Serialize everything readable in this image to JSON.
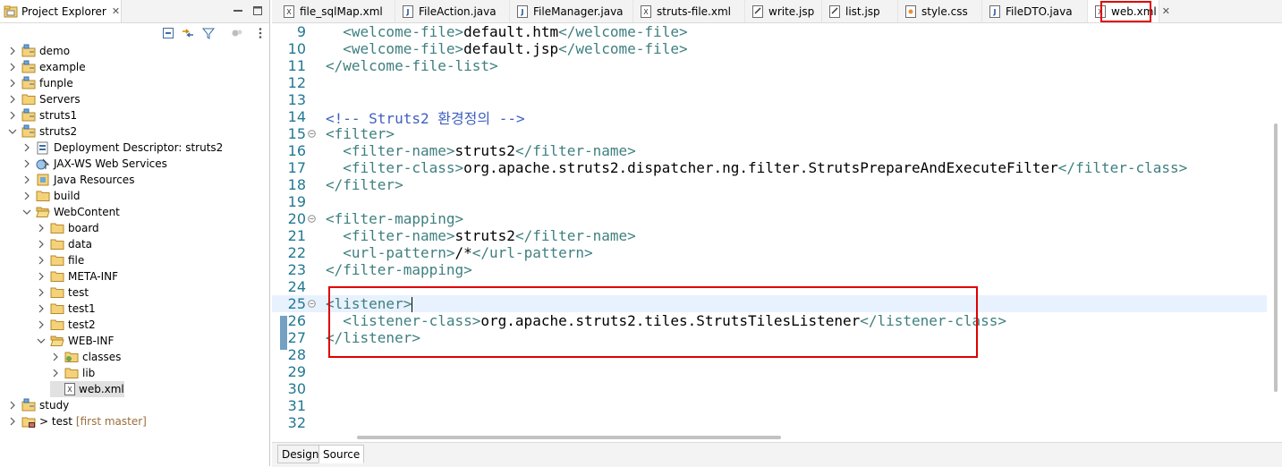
{
  "explorer": {
    "title": "Project Explorer",
    "close_glyph": "✕",
    "tree": [
      {
        "label": "demo",
        "depth": 0,
        "arrow": "collapsed",
        "icon": "project-icon"
      },
      {
        "label": "example",
        "depth": 0,
        "arrow": "collapsed",
        "icon": "project-icon"
      },
      {
        "label": "funple",
        "depth": 0,
        "arrow": "collapsed",
        "icon": "project-icon"
      },
      {
        "label": "Servers",
        "depth": 0,
        "arrow": "collapsed",
        "icon": "folder-icon"
      },
      {
        "label": "struts1",
        "depth": 0,
        "arrow": "collapsed",
        "icon": "project-icon"
      },
      {
        "label": "struts2",
        "depth": 0,
        "arrow": "expanded",
        "icon": "project-icon"
      },
      {
        "label": "Deployment Descriptor: struts2",
        "depth": 1,
        "arrow": "collapsed",
        "icon": "deployment-descriptor-icon"
      },
      {
        "label": "JAX-WS Web Services",
        "depth": 1,
        "arrow": "collapsed",
        "icon": "web-services-icon"
      },
      {
        "label": "Java Resources",
        "depth": 1,
        "arrow": "collapsed",
        "icon": "java-resources-icon"
      },
      {
        "label": "build",
        "depth": 1,
        "arrow": "collapsed",
        "icon": "folder-icon"
      },
      {
        "label": "WebContent",
        "depth": 1,
        "arrow": "expanded",
        "icon": "folder-open-icon"
      },
      {
        "label": "board",
        "depth": 2,
        "arrow": "collapsed",
        "icon": "folder-icon"
      },
      {
        "label": "data",
        "depth": 2,
        "arrow": "collapsed",
        "icon": "folder-icon"
      },
      {
        "label": "file",
        "depth": 2,
        "arrow": "collapsed",
        "icon": "folder-icon"
      },
      {
        "label": "META-INF",
        "depth": 2,
        "arrow": "collapsed",
        "icon": "folder-icon"
      },
      {
        "label": "test",
        "depth": 2,
        "arrow": "collapsed",
        "icon": "folder-icon"
      },
      {
        "label": "test1",
        "depth": 2,
        "arrow": "collapsed",
        "icon": "folder-icon"
      },
      {
        "label": "test2",
        "depth": 2,
        "arrow": "collapsed",
        "icon": "folder-icon"
      },
      {
        "label": "WEB-INF",
        "depth": 2,
        "arrow": "expanded",
        "icon": "folder-open-icon"
      },
      {
        "label": "classes",
        "depth": 3,
        "arrow": "collapsed",
        "icon": "classes-folder-icon"
      },
      {
        "label": "lib",
        "depth": 3,
        "arrow": "collapsed",
        "icon": "folder-icon"
      },
      {
        "label": "web.xml",
        "depth": 3,
        "arrow": "none",
        "icon": "xml-file-icon",
        "selected": true
      },
      {
        "label": "study",
        "depth": 0,
        "arrow": "collapsed",
        "icon": "project-icon"
      },
      {
        "label": "> test",
        "depth": 0,
        "arrow": "collapsed",
        "icon": "git-project-icon",
        "decoration": "[first master]"
      }
    ]
  },
  "editor": {
    "tabs": [
      {
        "label": "file_sqlMap.xml",
        "icon": "xml-file-icon"
      },
      {
        "label": "FileAction.java",
        "icon": "java-file-icon"
      },
      {
        "label": "FileManager.java",
        "icon": "java-file-icon"
      },
      {
        "label": "struts-file.xml",
        "icon": "xml-file-icon"
      },
      {
        "label": "write.jsp",
        "icon": "jsp-file-icon"
      },
      {
        "label": "list.jsp",
        "icon": "jsp-file-icon"
      },
      {
        "label": "style.css",
        "icon": "css-file-icon"
      },
      {
        "label": "FileDTO.java",
        "icon": "java-file-icon"
      },
      {
        "label": "web.xml",
        "icon": "xml-file-icon",
        "active": true
      }
    ],
    "close_glyph": "✕",
    "lines": [
      {
        "n": "9",
        "fold": false,
        "segments": [
          [
            "",
            "  "
          ],
          [
            "tag",
            "<welcome-file>"
          ],
          [
            "",
            "default.htm"
          ],
          [
            "tag",
            "</welcome-file>"
          ]
        ]
      },
      {
        "n": "10",
        "fold": false,
        "segments": [
          [
            "",
            "  "
          ],
          [
            "tag",
            "<welcome-file>"
          ],
          [
            "",
            "default.jsp"
          ],
          [
            "tag",
            "</welcome-file>"
          ]
        ]
      },
      {
        "n": "11",
        "fold": false,
        "segments": [
          [
            "tag",
            "</welcome-file-list>"
          ]
        ]
      },
      {
        "n": "12",
        "fold": false,
        "segments": []
      },
      {
        "n": "13",
        "fold": false,
        "segments": []
      },
      {
        "n": "14",
        "fold": false,
        "segments": [
          [
            "cmt",
            "<!-- Struts2 환경정의 -->"
          ]
        ]
      },
      {
        "n": "15",
        "fold": true,
        "segments": [
          [
            "tag",
            "<filter>"
          ]
        ]
      },
      {
        "n": "16",
        "fold": false,
        "segments": [
          [
            "",
            "  "
          ],
          [
            "tag",
            "<filter-name>"
          ],
          [
            "",
            "struts2"
          ],
          [
            "tag",
            "</filter-name>"
          ]
        ]
      },
      {
        "n": "17",
        "fold": false,
        "segments": [
          [
            "",
            "  "
          ],
          [
            "tag",
            "<filter-class>"
          ],
          [
            "",
            "org.apache.struts2.dispatcher.ng.filter.StrutsPrepareAndExecuteFilter"
          ],
          [
            "tag",
            "</filter-class>"
          ]
        ]
      },
      {
        "n": "18",
        "fold": false,
        "segments": [
          [
            "tag",
            "</filter>"
          ]
        ]
      },
      {
        "n": "19",
        "fold": false,
        "segments": []
      },
      {
        "n": "20",
        "fold": true,
        "segments": [
          [
            "tag",
            "<filter-mapping>"
          ]
        ]
      },
      {
        "n": "21",
        "fold": false,
        "segments": [
          [
            "",
            "  "
          ],
          [
            "tag",
            "<filter-name>"
          ],
          [
            "",
            "struts2"
          ],
          [
            "tag",
            "</filter-name>"
          ]
        ]
      },
      {
        "n": "22",
        "fold": false,
        "segments": [
          [
            "",
            "  "
          ],
          [
            "tag",
            "<url-pattern>"
          ],
          [
            "",
            "/*"
          ],
          [
            "tag",
            "</url-pattern>"
          ]
        ]
      },
      {
        "n": "23",
        "fold": false,
        "segments": [
          [
            "tag",
            "</filter-mapping>"
          ]
        ]
      },
      {
        "n": "24",
        "fold": false,
        "segments": []
      },
      {
        "n": "25",
        "fold": true,
        "current": true,
        "segments": [
          [
            "tag",
            "<listener>"
          ]
        ]
      },
      {
        "n": "26",
        "fold": false,
        "segments": [
          [
            "",
            "  "
          ],
          [
            "tag",
            "<listener-class>"
          ],
          [
            "",
            "org.apache.struts2.tiles.StrutsTilesListener"
          ],
          [
            "tag",
            "</listener-class>"
          ]
        ]
      },
      {
        "n": "27",
        "fold": false,
        "segments": [
          [
            "tag",
            "</listener>"
          ]
        ]
      },
      {
        "n": "28",
        "fold": false,
        "segments": []
      },
      {
        "n": "29",
        "fold": false,
        "segments": []
      },
      {
        "n": "30",
        "fold": false,
        "segments": []
      },
      {
        "n": "31",
        "fold": false,
        "segments": []
      },
      {
        "n": "32",
        "fold": false,
        "segments": []
      }
    ],
    "bottom_tabs": [
      {
        "label": "Design",
        "active": false
      },
      {
        "label": "Source",
        "active": true
      }
    ]
  },
  "colors": {
    "tag": "#3f7f7f",
    "comment": "#3f5fbf",
    "line_number": "#237893",
    "highlight_box": "#e00000",
    "current_line": "#e8f2fe"
  }
}
